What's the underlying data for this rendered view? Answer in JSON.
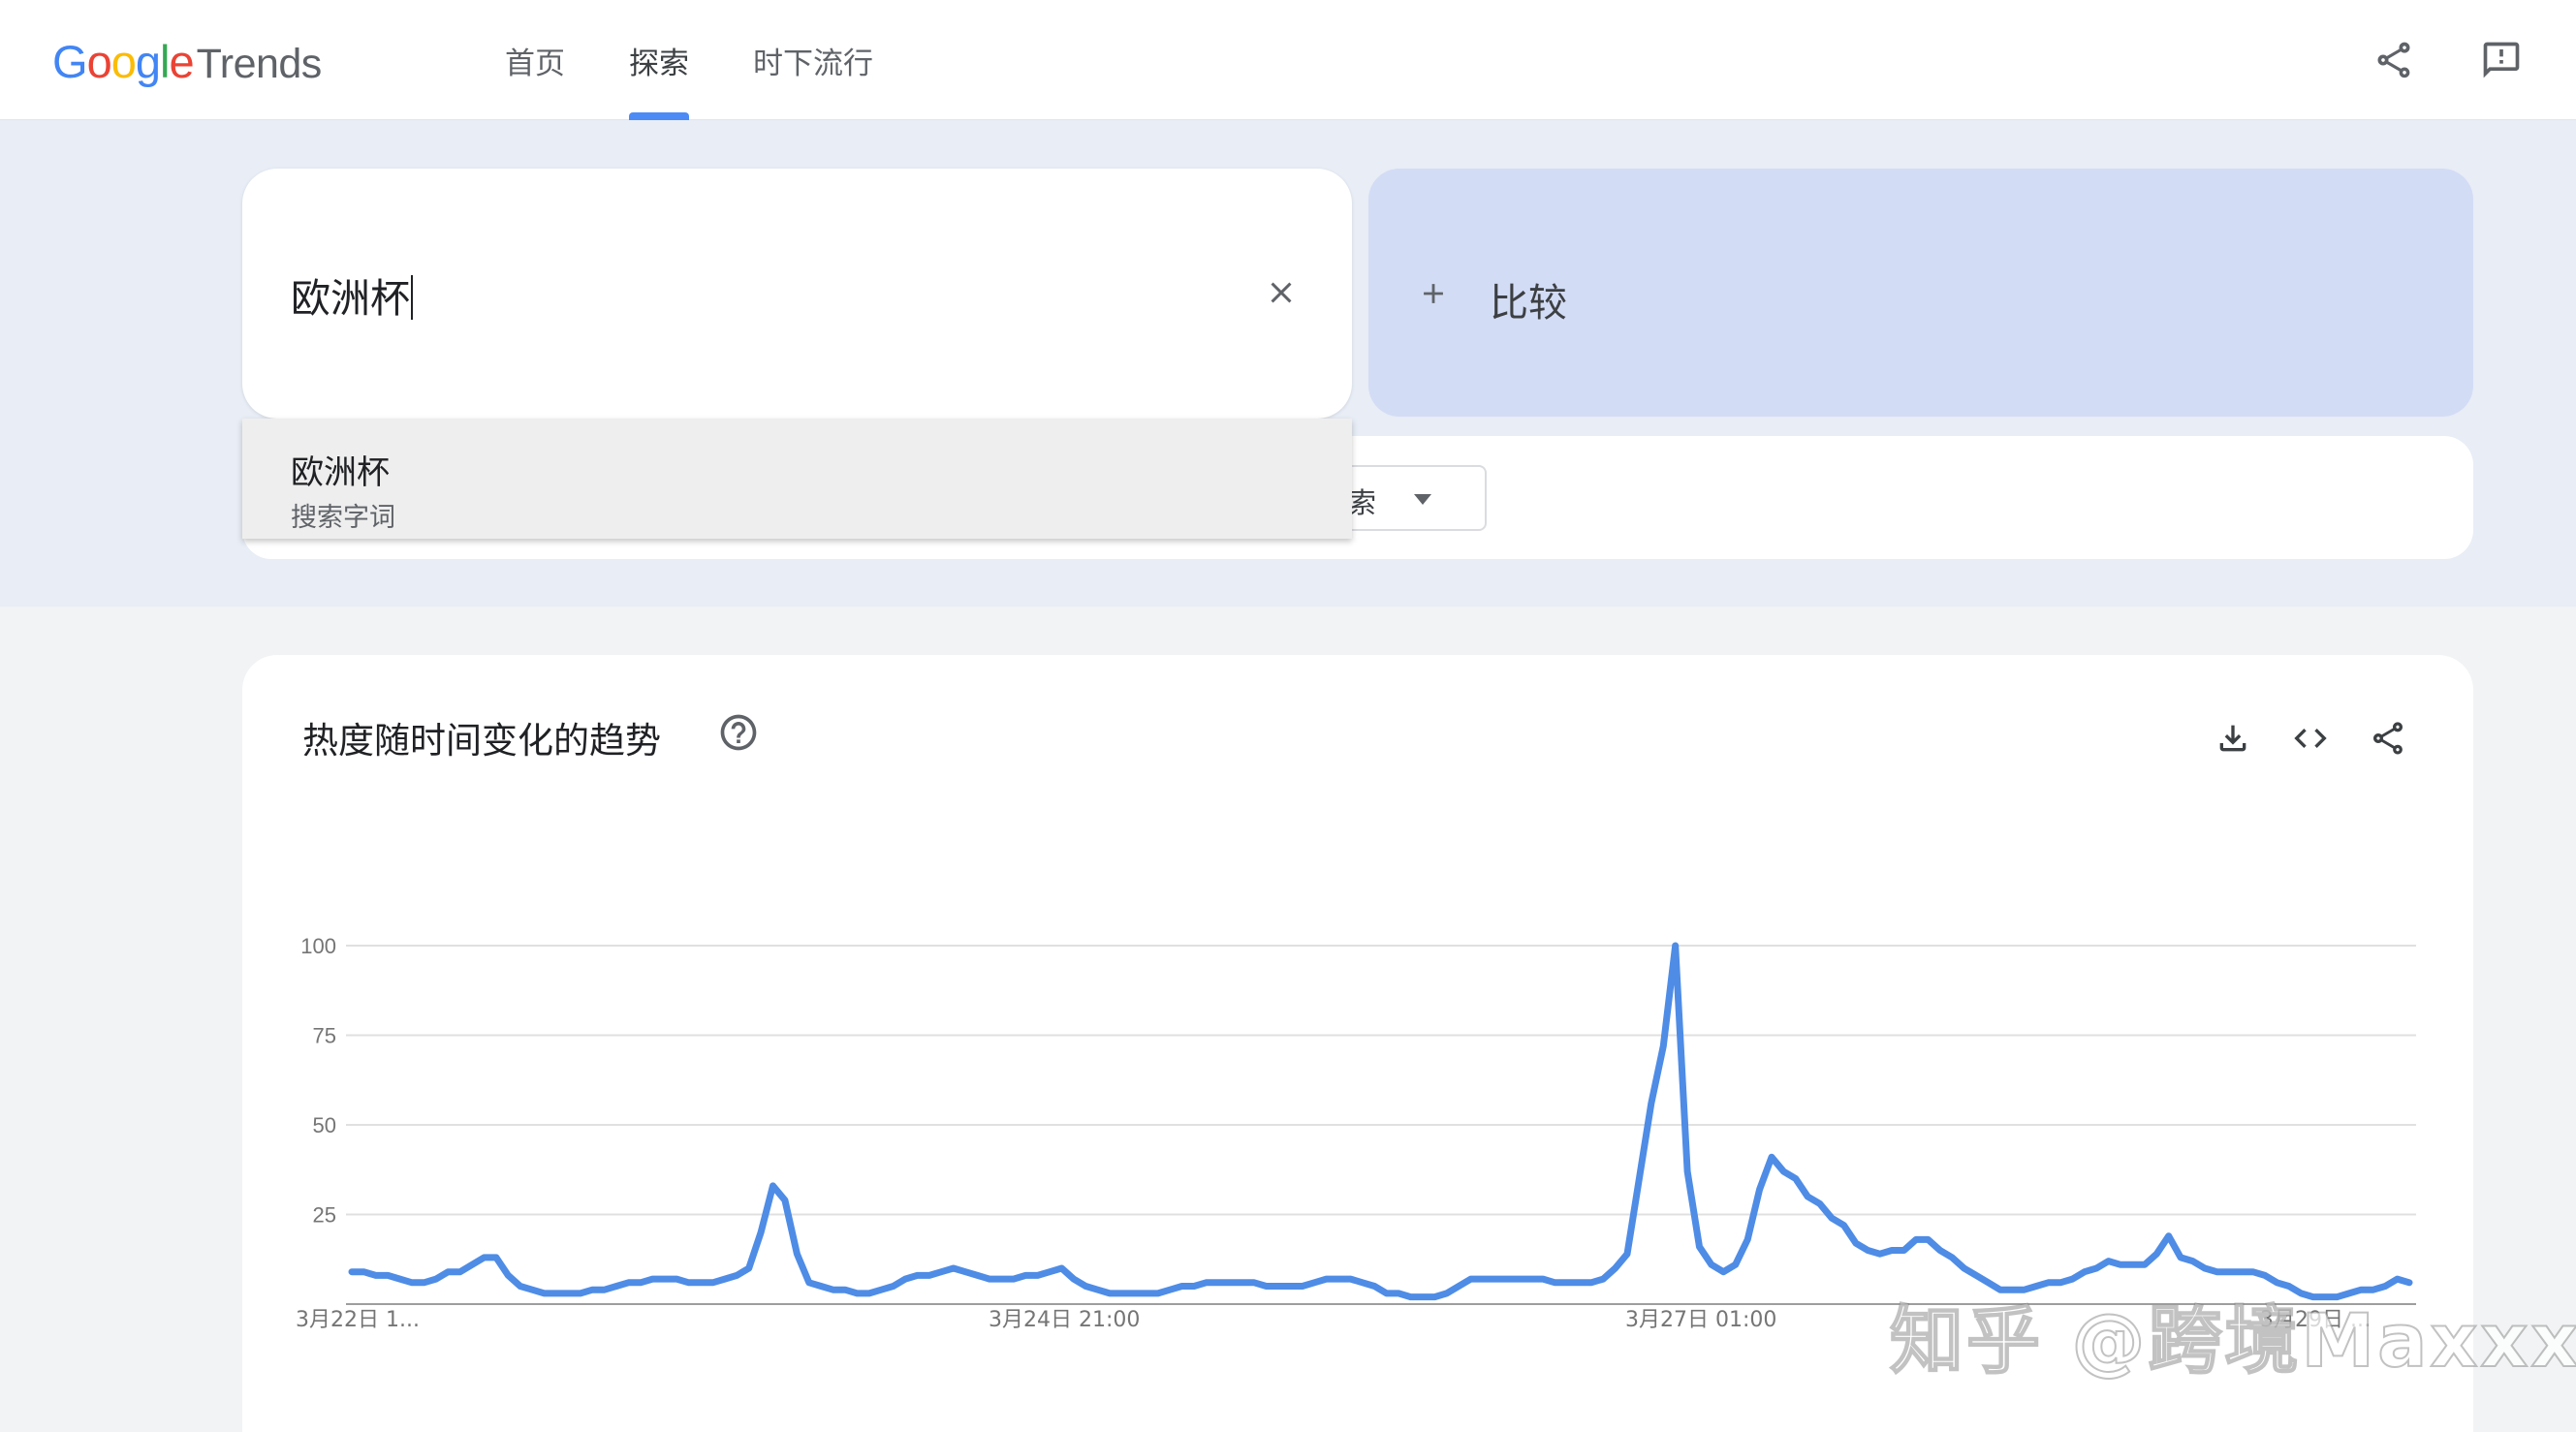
{
  "brand": {
    "google_letters": [
      {
        "ch": "G",
        "color": "#4285F4"
      },
      {
        "ch": "o",
        "color": "#EA4335"
      },
      {
        "ch": "o",
        "color": "#FBBC05"
      },
      {
        "ch": "g",
        "color": "#4285F4"
      },
      {
        "ch": "l",
        "color": "#34A853"
      },
      {
        "ch": "e",
        "color": "#EA4335"
      }
    ],
    "product": "Trends"
  },
  "nav": {
    "tabs": [
      {
        "label": "首页",
        "active": false
      },
      {
        "label": "探索",
        "active": true
      },
      {
        "label": "时下流行",
        "active": false
      }
    ]
  },
  "header_icons": [
    "share-icon",
    "feedback-icon"
  ],
  "search": {
    "value": "欧洲杯",
    "clear_icon": "close-icon"
  },
  "compare": {
    "icon": "plus-icon",
    "label": "比较"
  },
  "filter": {
    "visible_label": "搜索"
  },
  "suggestion": {
    "title": "欧洲杯",
    "subtitle": "搜索字词"
  },
  "chart_card": {
    "title": "热度随时间变化的趋势",
    "icons": [
      "help-icon",
      "download-icon",
      "embed-icon",
      "share-icon"
    ]
  },
  "chart_data": {
    "type": "line",
    "title": "热度随时间变化的趋势",
    "xlabel": "",
    "ylabel": "",
    "ylim": [
      0,
      100
    ],
    "yticks": [
      100,
      75,
      50,
      25
    ],
    "xticks": [
      "3月22日 1...",
      "3月24日 21:00",
      "3月27日 01:00",
      "3月29日 ..."
    ],
    "grid": true,
    "line_color": "#4e8ce6",
    "series": [
      {
        "values": [
          9,
          9,
          8,
          8,
          7,
          6,
          6,
          7,
          9,
          9,
          11,
          13,
          13,
          8,
          5,
          4,
          3,
          3,
          3,
          3,
          4,
          4,
          5,
          6,
          6,
          7,
          7,
          7,
          6,
          6,
          6,
          7,
          8,
          10,
          20,
          33,
          29,
          14,
          6,
          5,
          4,
          4,
          3,
          3,
          4,
          5,
          7,
          8,
          8,
          9,
          10,
          9,
          8,
          7,
          7,
          7,
          8,
          8,
          9,
          10,
          7,
          5,
          4,
          3,
          3,
          3,
          3,
          3,
          4,
          5,
          5,
          6,
          6,
          6,
          6,
          6,
          5,
          5,
          5,
          5,
          6,
          7,
          7,
          7,
          6,
          5,
          3,
          3,
          2,
          2,
          2,
          3,
          5,
          7,
          7,
          7,
          7,
          7,
          7,
          7,
          6,
          6,
          6,
          6,
          7,
          10,
          14,
          35,
          56,
          72,
          100,
          37,
          16,
          11,
          9,
          11,
          18,
          32,
          41,
          37,
          35,
          30,
          28,
          24,
          22,
          17,
          15,
          14,
          15,
          15,
          18,
          18,
          15,
          13,
          10,
          8,
          6,
          4,
          4,
          4,
          5,
          6,
          6,
          7,
          9,
          10,
          12,
          11,
          11,
          11,
          14,
          19,
          13,
          12,
          10,
          9,
          9,
          9,
          9,
          8,
          6,
          5,
          3,
          2,
          2,
          2,
          3,
          4,
          4,
          5,
          7,
          6
        ]
      }
    ]
  },
  "watermark": "知乎 @跨境Maxxx"
}
